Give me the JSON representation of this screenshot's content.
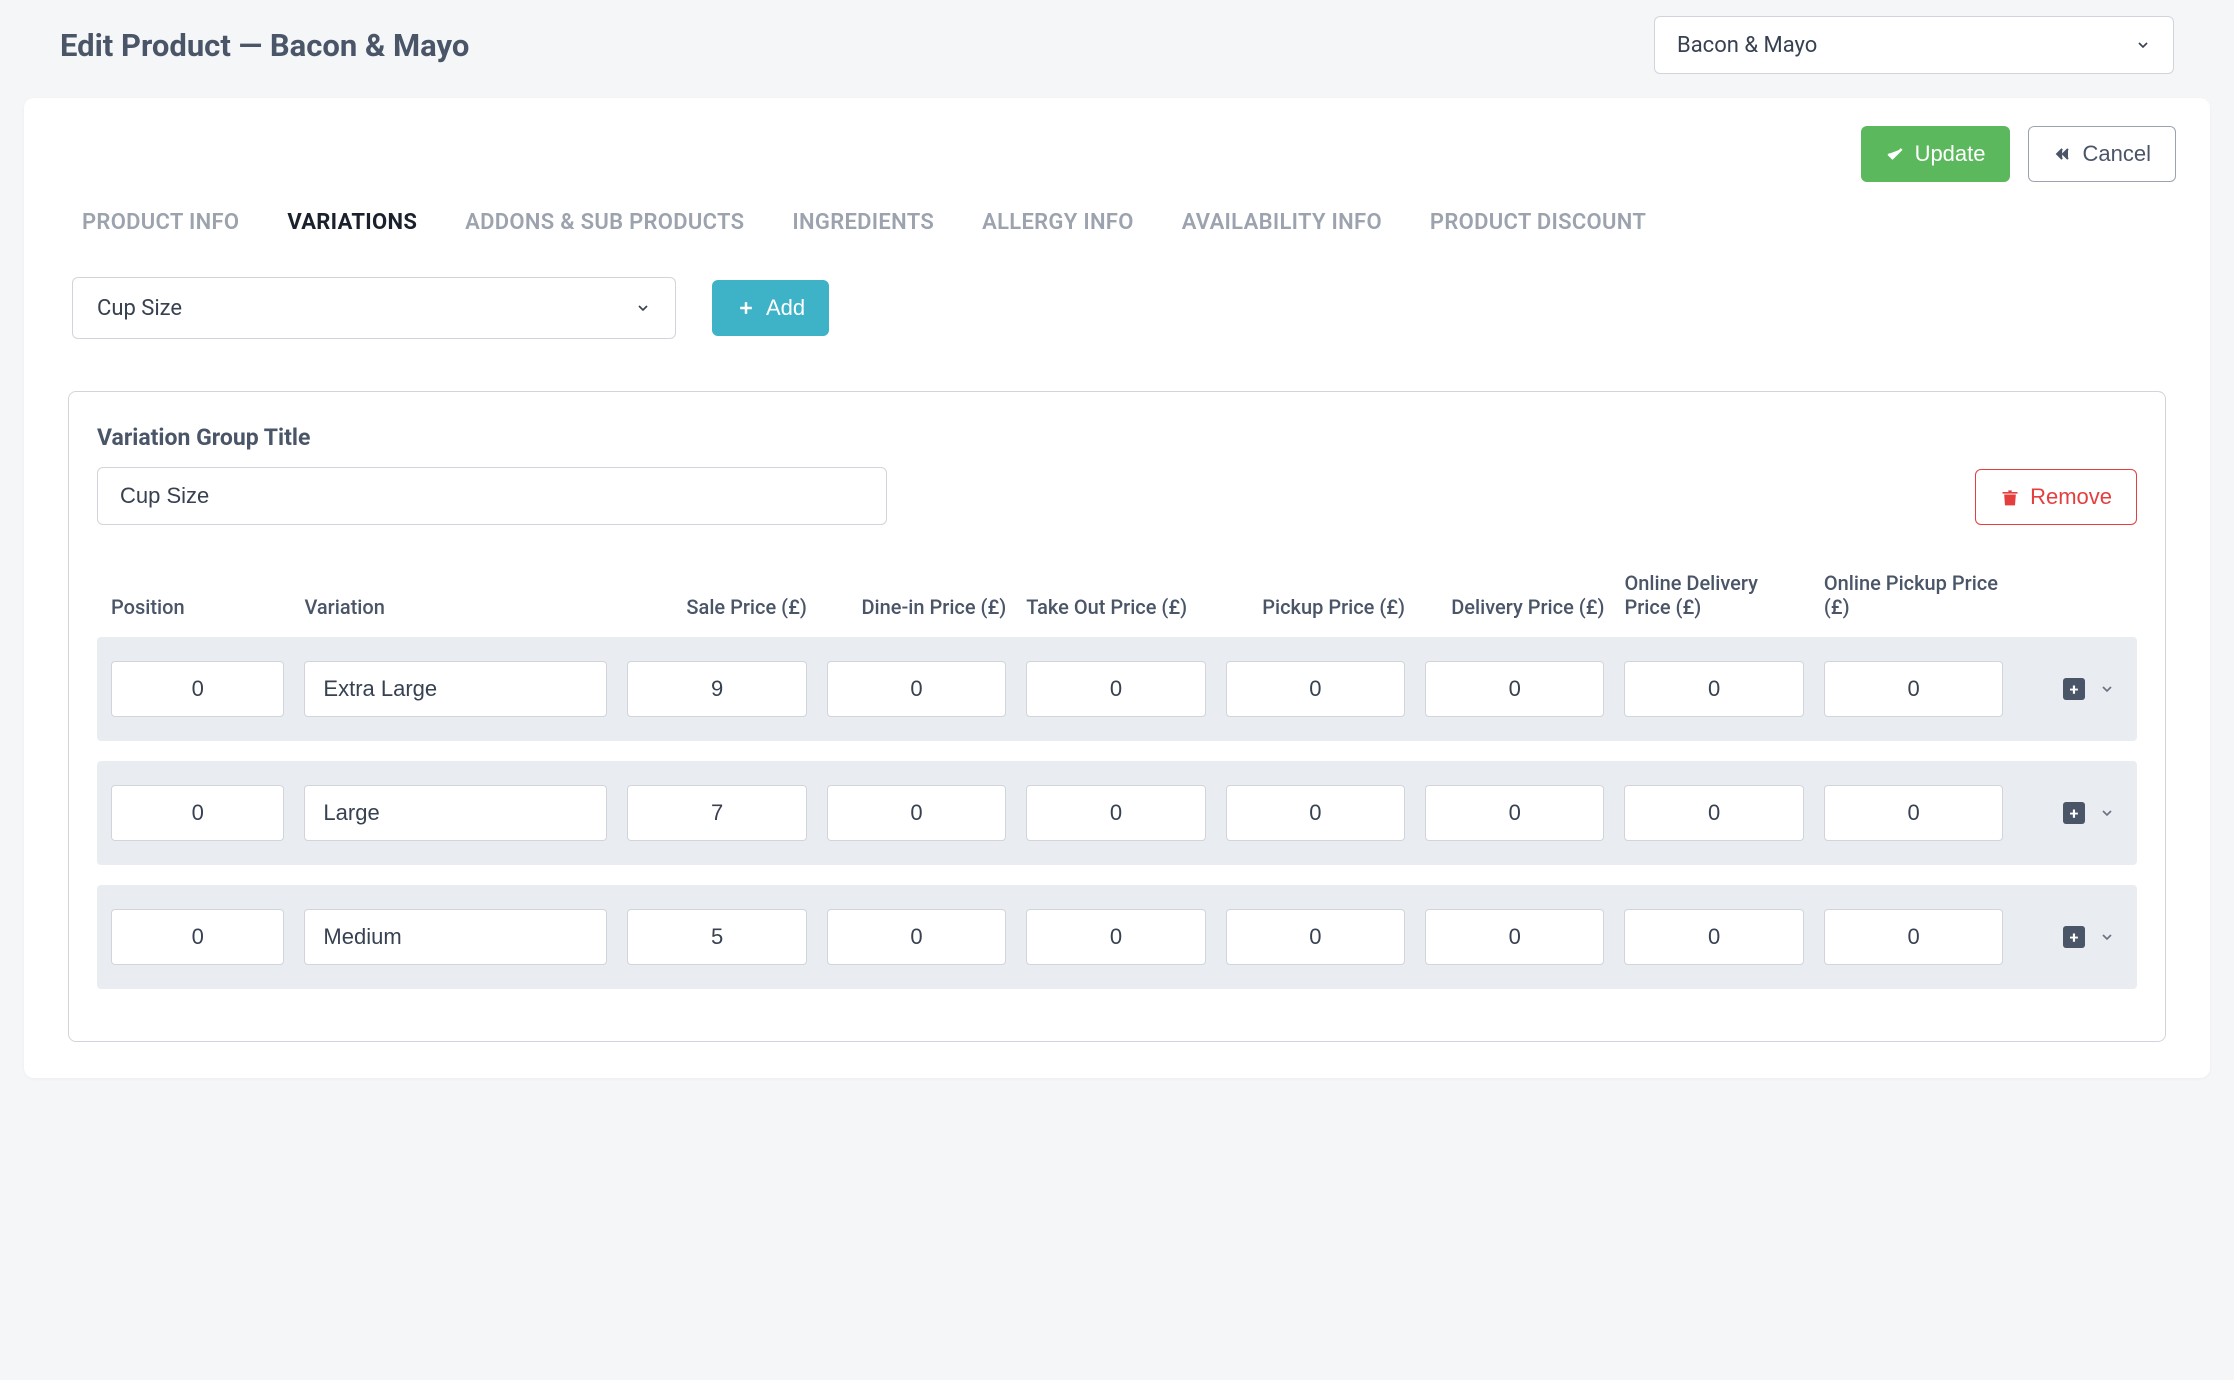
{
  "header": {
    "page_title": "Edit Product — Bacon & Mayo",
    "product_select_value": "Bacon & Mayo"
  },
  "actions": {
    "update_label": "Update",
    "cancel_label": "Cancel"
  },
  "tabs": [
    {
      "label": "PRODUCT INFO",
      "active": false
    },
    {
      "label": "VARIATIONS",
      "active": true
    },
    {
      "label": "ADDONS & SUB PRODUCTS",
      "active": false
    },
    {
      "label": "INGREDIENTS",
      "active": false
    },
    {
      "label": "ALLERGY INFO",
      "active": false
    },
    {
      "label": "AVAILABILITY INFO",
      "active": false
    },
    {
      "label": "PRODUCT DISCOUNT",
      "active": false
    }
  ],
  "variation_dropdown": {
    "value": "Cup Size",
    "add_button": "Add"
  },
  "variation_group": {
    "label": "Variation Group Title",
    "title_value": "Cup Size",
    "remove_label": "Remove",
    "columns": {
      "position": "Position",
      "variation": "Variation",
      "sale_price": "Sale Price (£)",
      "dinein_price": "Dine-in Price (£)",
      "takeout_price": "Take Out Price (£)",
      "pickup_price": "Pickup Price (£)",
      "delivery_price": "Delivery Price (£)",
      "online_delivery_price": "Online Delivery Price (£)",
      "online_pickup_price": "Online Pickup Price (£)"
    },
    "rows": [
      {
        "position": "0",
        "variation": "Extra Large",
        "sale": "9",
        "dinein": "0",
        "takeout": "0",
        "pickup": "0",
        "delivery": "0",
        "online_delivery": "0",
        "online_pickup": "0"
      },
      {
        "position": "0",
        "variation": "Large",
        "sale": "7",
        "dinein": "0",
        "takeout": "0",
        "pickup": "0",
        "delivery": "0",
        "online_delivery": "0",
        "online_pickup": "0"
      },
      {
        "position": "0",
        "variation": "Medium",
        "sale": "5",
        "dinein": "0",
        "takeout": "0",
        "pickup": "0",
        "delivery": "0",
        "online_delivery": "0",
        "online_pickup": "0"
      }
    ]
  }
}
